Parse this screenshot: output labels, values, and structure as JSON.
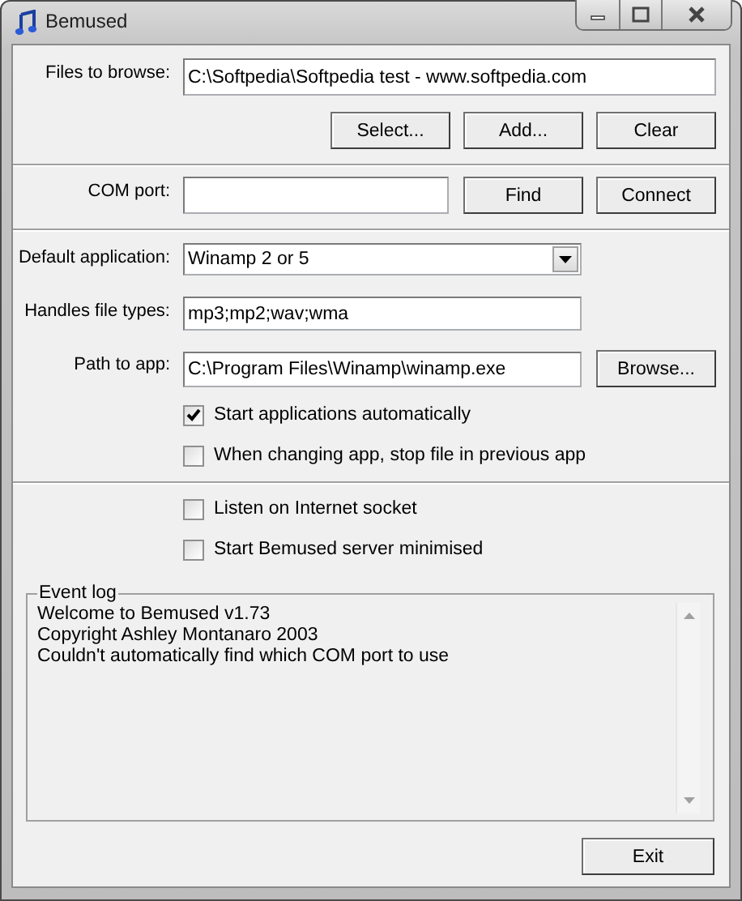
{
  "window": {
    "title": "Bemused"
  },
  "files": {
    "label": "Files to browse:",
    "value": "C:\\Softpedia\\Softpedia test - www.softpedia.com",
    "buttons": [
      "Select...",
      "Add...",
      "Clear"
    ]
  },
  "com_port": {
    "label": "COM port:",
    "buttons": [
      "Find",
      "Connect"
    ]
  },
  "default_application": {
    "label": "Default application:",
    "value": "Winamp 2 or 5"
  },
  "file_types": {
    "label": "Handles file types:",
    "value": "mp3;mp2;wav;wma"
  },
  "path": {
    "label": "Path to app:",
    "value": "C:\\Program Files\\Winamp\\winamp.exe",
    "button": "Browse..."
  },
  "app_options": [
    {
      "label": "Start applications automatically",
      "checked": true
    },
    {
      "label": "When changing app, stop file in previous app",
      "checked": false
    }
  ],
  "server_options": [
    {
      "label": "Listen on Internet socket",
      "checked": false
    },
    {
      "label": "Start Bemused server minimised",
      "checked": false
    }
  ],
  "event_log": {
    "title": "Event log",
    "lines": [
      "Welcome to Bemused v1.73",
      "Copyright Ashley Montanaro 2003",
      "Couldn't automatically find which COM port to use"
    ]
  },
  "exit_button": "Exit"
}
